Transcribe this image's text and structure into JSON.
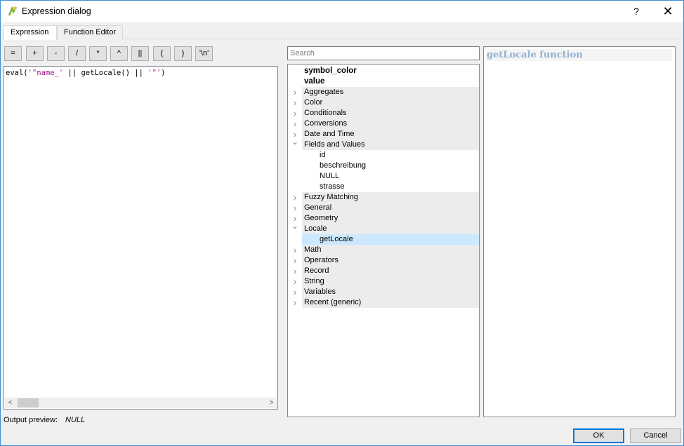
{
  "window": {
    "title": "Expression dialog",
    "help_label": "?",
    "close_label": "✕"
  },
  "tabs": [
    {
      "label": "Expression",
      "active": true
    },
    {
      "label": "Function Editor",
      "active": false
    }
  ],
  "operators": [
    "=",
    "+",
    "-",
    "/",
    "*",
    "^",
    "||",
    "(",
    ")",
    "'\\n'"
  ],
  "editor": {
    "tokens": [
      {
        "text": "eval(",
        "type": "plain"
      },
      {
        "text": "'\"name_'",
        "type": "string"
      },
      {
        "text": " || getLocale() || ",
        "type": "plain"
      },
      {
        "text": "'\"'",
        "type": "string"
      },
      {
        "text": ")",
        "type": "plain"
      }
    ]
  },
  "output_preview": {
    "label": "Output preview:",
    "value": "NULL"
  },
  "search": {
    "placeholder": "Search"
  },
  "tree": [
    {
      "label": "symbol_color",
      "kind": "bold"
    },
    {
      "label": "value",
      "kind": "bold"
    },
    {
      "label": "Aggregates",
      "kind": "group",
      "expanded": false
    },
    {
      "label": "Color",
      "kind": "group",
      "expanded": false
    },
    {
      "label": "Conditionals",
      "kind": "group",
      "expanded": false
    },
    {
      "label": "Conversions",
      "kind": "group",
      "expanded": false
    },
    {
      "label": "Date and Time",
      "kind": "group",
      "expanded": false
    },
    {
      "label": "Fields and Values",
      "kind": "group",
      "expanded": true
    },
    {
      "label": "id",
      "kind": "child"
    },
    {
      "label": "beschreibung",
      "kind": "child"
    },
    {
      "label": "NULL",
      "kind": "child"
    },
    {
      "label": "strasse",
      "kind": "child"
    },
    {
      "label": "Fuzzy Matching",
      "kind": "group",
      "expanded": false
    },
    {
      "label": "General",
      "kind": "group",
      "expanded": false
    },
    {
      "label": "Geometry",
      "kind": "group",
      "expanded": false
    },
    {
      "label": "Locale",
      "kind": "group",
      "expanded": true
    },
    {
      "label": "getLocale",
      "kind": "child",
      "selected": true
    },
    {
      "label": "Math",
      "kind": "group",
      "expanded": false
    },
    {
      "label": "Operators",
      "kind": "group",
      "expanded": false
    },
    {
      "label": "Record",
      "kind": "group",
      "expanded": false
    },
    {
      "label": "String",
      "kind": "group",
      "expanded": false
    },
    {
      "label": "Variables",
      "kind": "group",
      "expanded": false
    },
    {
      "label": "Recent (generic)",
      "kind": "group",
      "expanded": false
    }
  ],
  "help_panel": {
    "title": "getLocale function"
  },
  "buttons": {
    "ok": "OK",
    "cancel": "Cancel"
  },
  "colors": {
    "accent": "#0078d7",
    "selection": "#cce8ff",
    "string_literal": "#a01090",
    "help_title": "#93b0d0"
  }
}
